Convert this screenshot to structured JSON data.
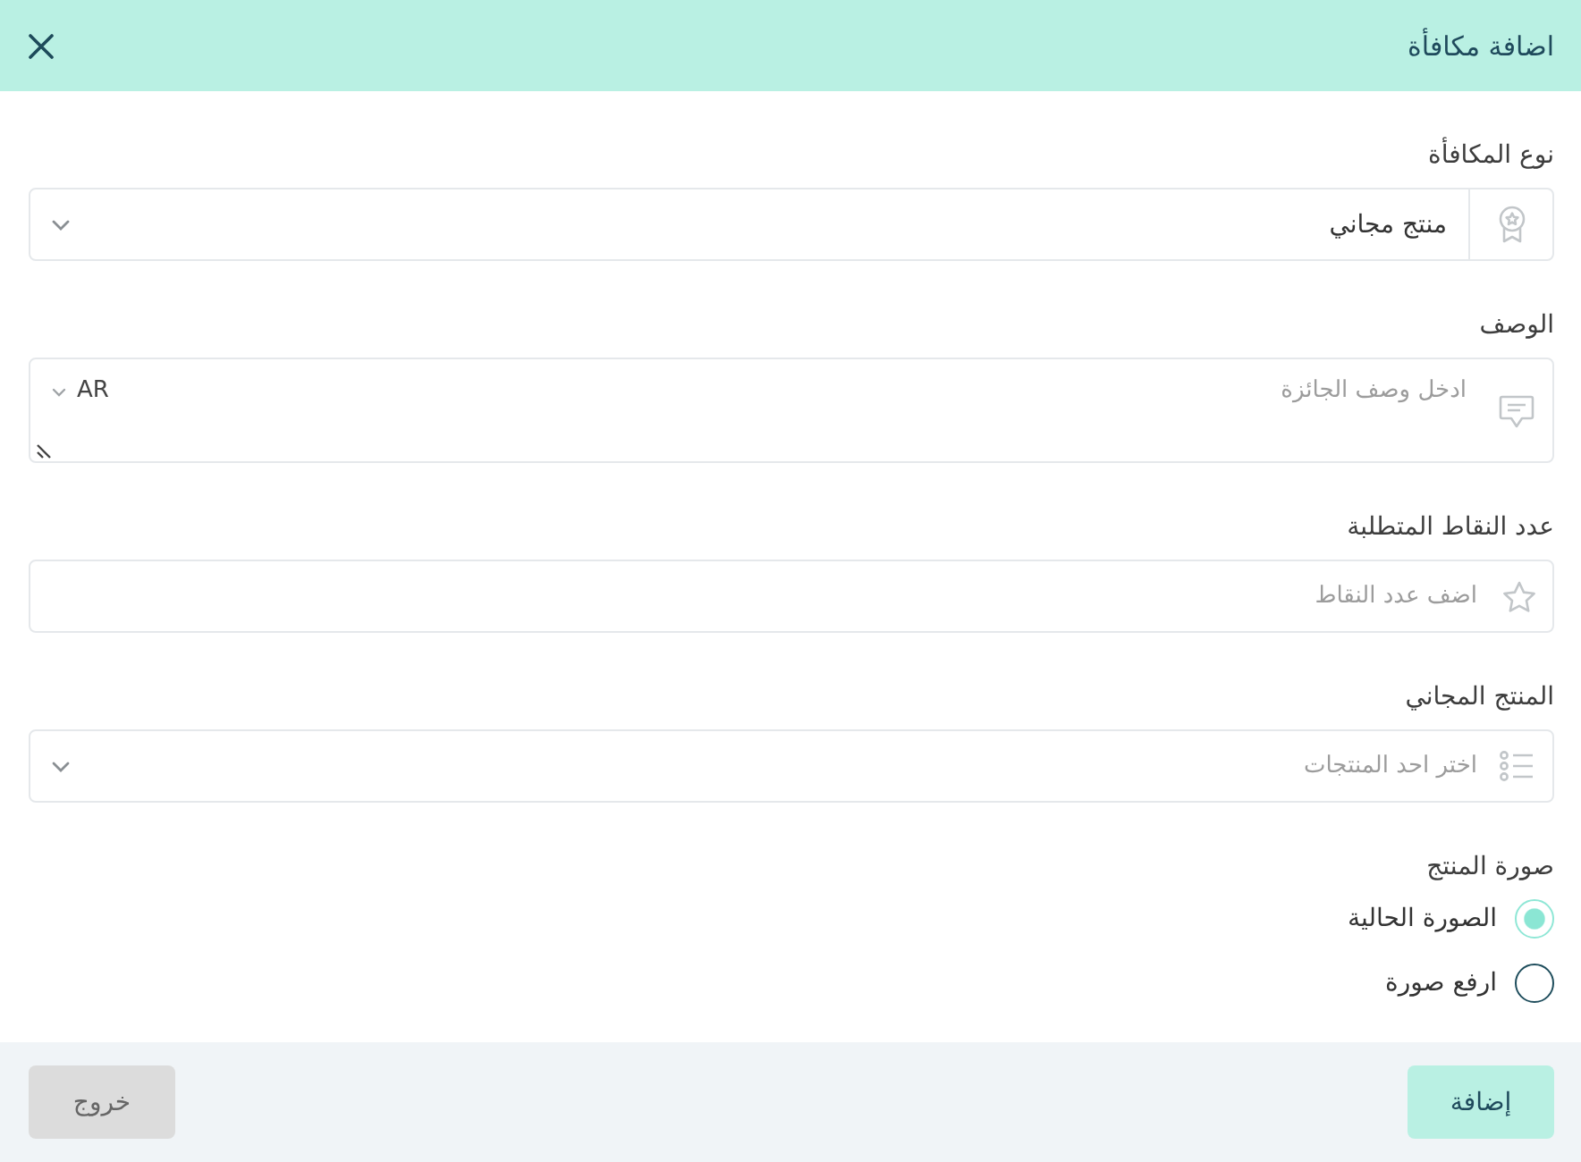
{
  "dialog": {
    "title": "اضافة مكافأة"
  },
  "reward_type": {
    "label": "نوع المكافأة",
    "value": "منتج مجاني"
  },
  "description": {
    "label": "الوصف",
    "placeholder": "ادخل وصف الجائزة",
    "language": "AR"
  },
  "points": {
    "label": "عدد النقاط المتطلبة",
    "placeholder": "اضف عدد النقاط"
  },
  "free_product": {
    "label": "المنتج المجاني",
    "placeholder": "اختر احد المنتجات"
  },
  "product_image": {
    "label": "صورة المنتج",
    "options": [
      {
        "label": "الصورة الحالية",
        "selected": true
      },
      {
        "label": "ارفع صورة",
        "selected": false
      }
    ]
  },
  "footer": {
    "buttons": [
      {
        "label": "إضافة",
        "kind": "primary"
      },
      {
        "label": "خروج",
        "kind": "secondary"
      }
    ]
  }
}
